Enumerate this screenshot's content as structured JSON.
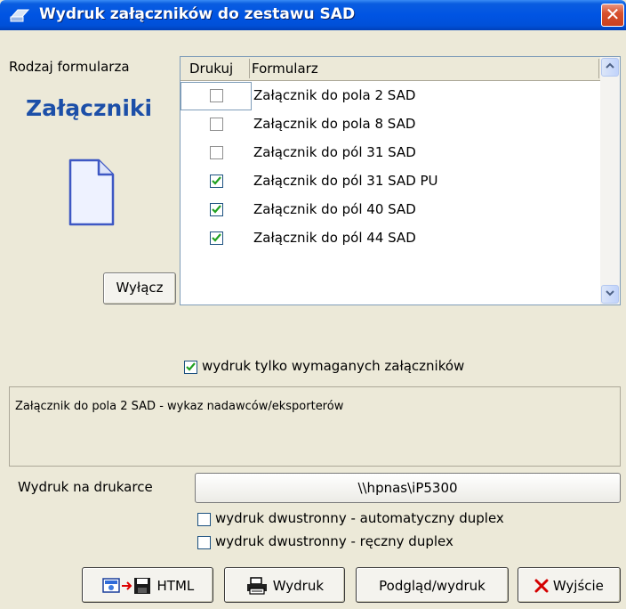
{
  "window": {
    "title": "Wydruk załączników do zestawu SAD",
    "close": "✕"
  },
  "left": {
    "form_type_label": "Rodzaj formularza",
    "heading": "Załączniki",
    "icon": "document-icon",
    "disable_button": "Wyłącz"
  },
  "table": {
    "headers": {
      "print": "Drukuj",
      "form": "Formularz"
    },
    "rows": [
      {
        "checked": false,
        "label": "Załącznik do pola 2 SAD"
      },
      {
        "checked": false,
        "label": "Załącznik do pola 8 SAD"
      },
      {
        "checked": false,
        "label": "Załącznik do pól 31 SAD"
      },
      {
        "checked": true,
        "label": "Załącznik do pól 31 SAD PU"
      },
      {
        "checked": true,
        "label": "Załącznik do pól 40 SAD"
      },
      {
        "checked": true,
        "label": "Załącznik do pól 44 SAD"
      }
    ]
  },
  "options": {
    "required_only": {
      "checked": true,
      "label": "wydruk tylko wymaganych załączników"
    }
  },
  "description": "Załącznik do pola 2 SAD - wykaz nadawców/eksporterów",
  "printer": {
    "label": "Wydruk na drukarce",
    "value": "\\\\hpnas\\iP5300",
    "duplex_auto": {
      "checked": false,
      "label": "wydruk dwustronny - automatyczny duplex"
    },
    "duplex_manual": {
      "checked": false,
      "label": "wydruk dwustronny - ręczny duplex"
    }
  },
  "buttons": {
    "html": "HTML",
    "print": "Wydruk",
    "preview": "Podgląd/wydruk",
    "exit": "Wyjście"
  },
  "colors": {
    "titlebar": "#0054E3",
    "heading": "#1C4FA8",
    "check": "#21A121",
    "exit_x": "#D40000"
  }
}
